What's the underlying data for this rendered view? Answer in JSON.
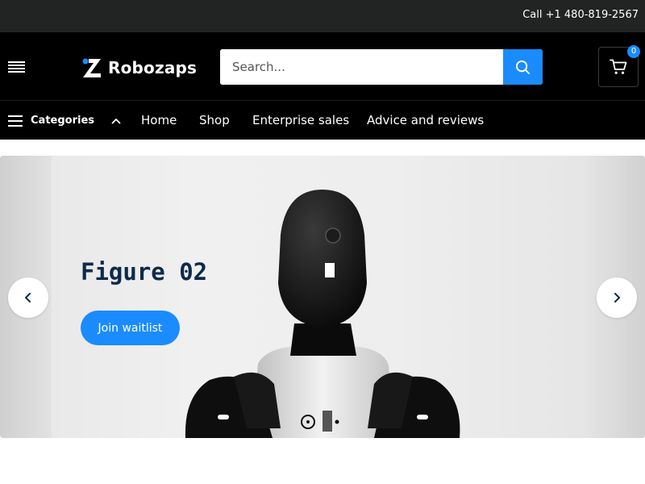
{
  "topbar": {
    "call": "Call +1 480-819-2567"
  },
  "header": {
    "logo_name": "Robozaps",
    "search_placeholder": "Search...",
    "cart_count": "0"
  },
  "nav": {
    "categories_label": "Categories",
    "links": [
      "Home",
      "Shop",
      "Enterprise sales",
      "Advice and reviews"
    ]
  },
  "hero": {
    "title": "Figure 02",
    "cta_label": "Join waitlist"
  },
  "icons": {
    "menu": "hamburger-icon",
    "search": "search-icon",
    "cart": "cart-icon",
    "chevron_up": "chevron-up-icon",
    "prev": "chevron-left-icon",
    "next": "chevron-right-icon"
  },
  "colors": {
    "accent": "#1a8cff",
    "topbar": "#222323",
    "header": "#000000",
    "hero_title": "#0d2a4a"
  }
}
